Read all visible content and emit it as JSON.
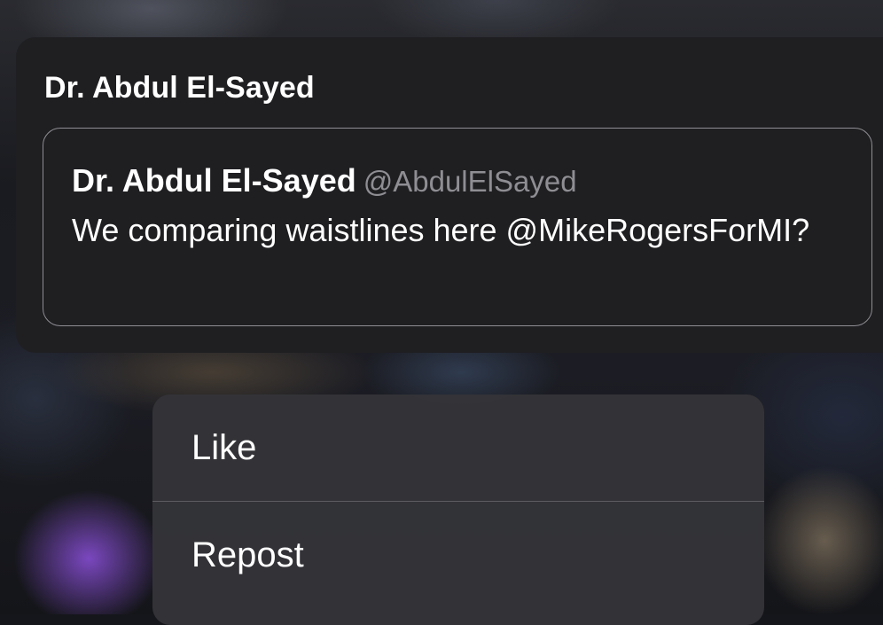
{
  "card": {
    "title": "Dr. Abdul El-Sayed"
  },
  "quote": {
    "author_name": "Dr. Abdul El-Sayed",
    "author_handle": "@AbdulElSayed",
    "text": "We comparing waistlines here @MikeRogersForMI?"
  },
  "menu": {
    "items": [
      {
        "label": "Like"
      },
      {
        "label": "Repost"
      }
    ]
  },
  "colors": {
    "card_background": "#1f1f22",
    "menu_background": "#343438",
    "text_primary": "#ffffff",
    "text_secondary": "#8e8e93",
    "border": "#8e8e93"
  }
}
